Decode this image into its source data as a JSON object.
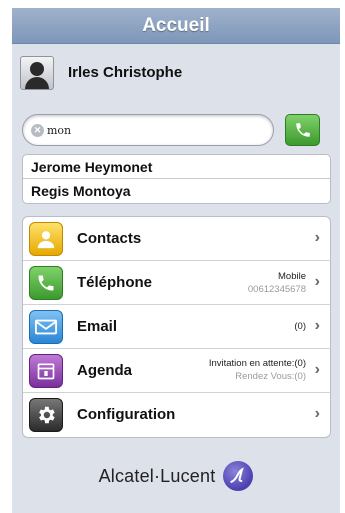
{
  "header": {
    "title": "Accueil"
  },
  "user": {
    "name": "Irles Christophe"
  },
  "search": {
    "value": "mon"
  },
  "results": [
    {
      "name": "Jerome Heymonet"
    },
    {
      "name": "Regis Montoya"
    }
  ],
  "menu": {
    "contacts": {
      "label": "Contacts",
      "icon": "contacts-icon"
    },
    "telephone": {
      "label": "Téléphone",
      "icon": "phone-icon",
      "info_line1": "Mobile",
      "info_line2": "00612345678"
    },
    "email": {
      "label": "Email",
      "icon": "email-icon",
      "info": "(0)"
    },
    "agenda": {
      "label": "Agenda",
      "icon": "calendar-icon",
      "info_line1": "Invitation en attente:(0)",
      "info_line2": "Rendez Vous:(0)"
    },
    "configuration": {
      "label": "Configuration",
      "icon": "gear-icon"
    }
  },
  "brand": {
    "name": "Alcatel·Lucent"
  },
  "colors": {
    "header": "#8ba0c0",
    "background": "#dde2ea",
    "call_green": "#4caf3a"
  }
}
